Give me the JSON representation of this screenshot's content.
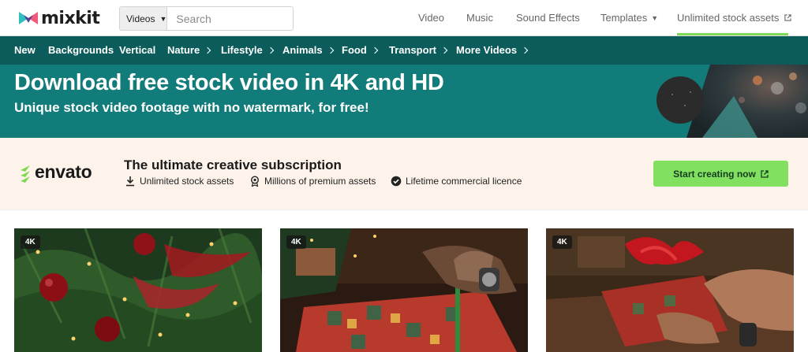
{
  "header": {
    "logo_text": "mixkit",
    "search": {
      "category": "Videos",
      "placeholder": "Search"
    },
    "nav": [
      {
        "label": "Video"
      },
      {
        "label": "Music"
      },
      {
        "label": "Sound Effects"
      },
      {
        "label": "Templates"
      },
      {
        "label": "Unlimited stock assets"
      }
    ]
  },
  "categories": [
    "New",
    "Backgrounds",
    "Vertical",
    "Nature",
    "Lifestyle",
    "Animals",
    "Food",
    "Transport",
    "More Videos"
  ],
  "hero": {
    "title": "Download free stock video in 4K and HD",
    "subtitle": "Unique stock video footage with no watermark, for free!"
  },
  "promo": {
    "brand": "envato",
    "title": "The ultimate creative subscription",
    "features": [
      "Unlimited stock assets",
      "Millions of premium assets",
      "Lifetime commercial licence"
    ],
    "cta": "Start creating now"
  },
  "cards": [
    {
      "badge": "4K"
    },
    {
      "badge": "4K"
    },
    {
      "badge": "4K"
    }
  ],
  "colors": {
    "category_bar": "#0c5c5c",
    "hero_bg": "#127c7a",
    "promo_bg": "#fdf3ea",
    "accent_green": "#82e061"
  }
}
